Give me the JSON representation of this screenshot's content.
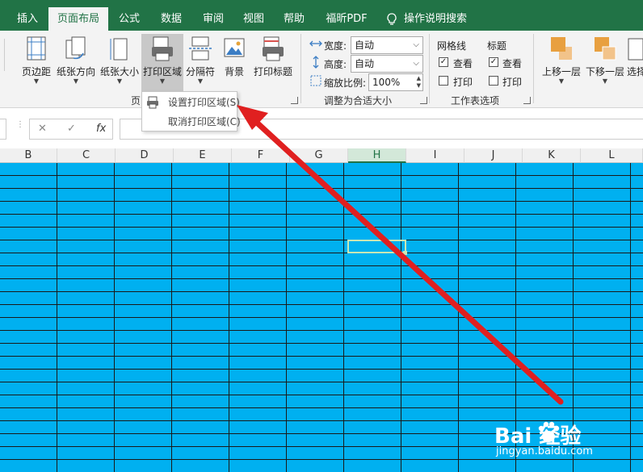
{
  "menu": {
    "tabs": [
      {
        "label": "插入"
      },
      {
        "label": "页面布局"
      },
      {
        "label": "公式"
      },
      {
        "label": "数据"
      },
      {
        "label": "审阅"
      },
      {
        "label": "视图"
      },
      {
        "label": "帮助"
      },
      {
        "label": "福昕PDF"
      }
    ],
    "active_tab": "页面布局",
    "tell_me": "操作说明搜索"
  },
  "ribbon": {
    "page_setup": {
      "margins": "页边距",
      "orientation": "纸张方向",
      "size": "纸张大小",
      "print_area": "打印区域",
      "breaks": "分隔符",
      "background": "背景",
      "print_titles": "打印标题",
      "group_label_partial": "页"
    },
    "scale_to_fit": {
      "width_label": "宽度:",
      "width_value": "自动",
      "height_label": "高度:",
      "height_value": "自动",
      "scale_label": "缩放比例:",
      "scale_value": "100%",
      "group_label": "调整为合适大小"
    },
    "sheet_options": {
      "gridlines_header": "网格线",
      "headings_header": "标题",
      "view_label": "查看",
      "print_label": "打印",
      "gridlines_view": true,
      "gridlines_print": false,
      "headings_view": true,
      "headings_print": false,
      "group_label": "工作表选项"
    },
    "arrange": {
      "bring_forward": "上移一层",
      "send_backward": "下移一层",
      "selection_partial": "选择"
    }
  },
  "dropdown": {
    "set_print_area": "设置打印区域(S)",
    "clear_print_area": "取消打印区域(C)"
  },
  "formula_bar": {
    "cancel": "✕",
    "enter": "✓",
    "fx": "fx"
  },
  "grid": {
    "columns": [
      "B",
      "C",
      "D",
      "E",
      "F",
      "G",
      "H",
      "I",
      "J",
      "K",
      "L"
    ],
    "selected_column": "H",
    "fill_color": "#00b0f0"
  },
  "watermark": {
    "brand": "Bai 经验",
    "url": "jingyan.baidu.com"
  },
  "colors": {
    "accent": "#217346",
    "arrow": "#e02020"
  }
}
